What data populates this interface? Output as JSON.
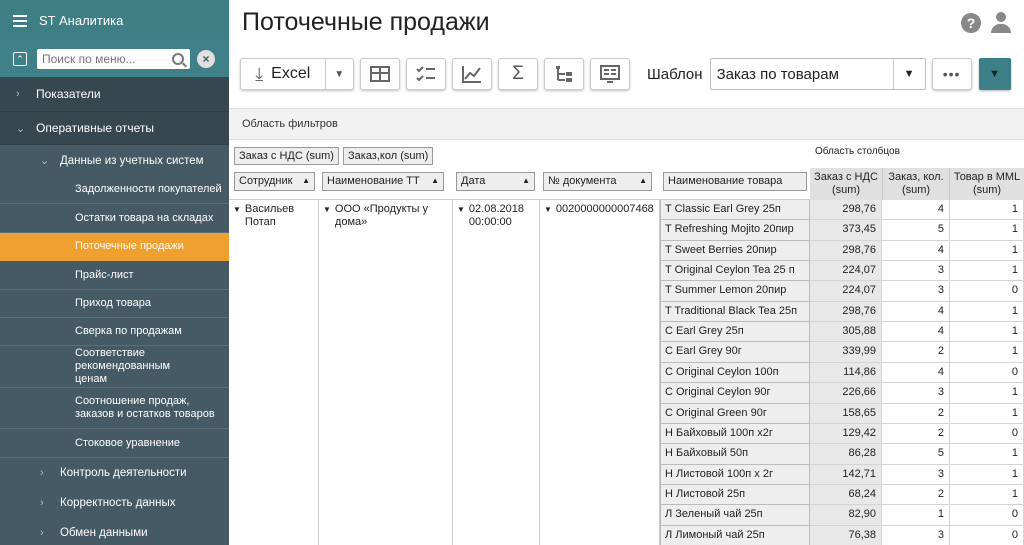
{
  "sidebar": {
    "app_title": "ST Аналитика",
    "search_placeholder": "Поиск по меню...",
    "items": [
      {
        "label": "Показатели"
      },
      {
        "label": "Оперативные отчеты"
      },
      {
        "label": "Данные из учетных систем"
      },
      {
        "label": "Задолженности покупателей"
      },
      {
        "label": "Остатки товара на складах"
      },
      {
        "label": "Поточечные продажи"
      },
      {
        "label": "Прайс-лист"
      },
      {
        "label": "Приход товара"
      },
      {
        "label": "Сверка по продажам"
      },
      {
        "label": "Соответствие рекомендованным ценам"
      },
      {
        "label": "Соотношение продаж, заказов и остатков товаров"
      },
      {
        "label": "Стоковое уравнение"
      },
      {
        "label": "Контроль деятельности"
      },
      {
        "label": "Корректность данных"
      },
      {
        "label": "Обмен данными"
      }
    ]
  },
  "header": {
    "title": "Поточечные продажи"
  },
  "toolbar": {
    "excel_label": "Excel",
    "template_label": "Шаблон",
    "template_value": "Заказ по товарам",
    "more_label": "•••"
  },
  "filters": {
    "area_label": "Область фильтров",
    "columns_area_label": "Область столбцов"
  },
  "value_chips": [
    "Заказ с НДС (sum)",
    "Заказ,кол (sum)"
  ],
  "row_headers": [
    "Сотрудник",
    "Наименование ТТ",
    "Дата",
    "№ документа",
    "Наименование товара"
  ],
  "column_headers": [
    "Заказ с НДС (sum)",
    "Заказ, кол. (sum)",
    "Товар в MML (sum)"
  ],
  "row_group": {
    "employee": "Васильев Потап",
    "store": "ООО «Продукты у дома»",
    "date": "02.08.2018 00:00:00",
    "doc": "0020000000007468"
  },
  "products": [
    {
      "name": "T Classic Earl Grey 25п",
      "sum": "298,76",
      "qty": "4",
      "mml": "1"
    },
    {
      "name": "T Refreshing Mojito 20пир",
      "sum": "373,45",
      "qty": "5",
      "mml": "1"
    },
    {
      "name": "T Sweet Berries 20пир",
      "sum": "298,76",
      "qty": "4",
      "mml": "1"
    },
    {
      "name": "T Original Ceylon Tea 25 п",
      "sum": "224,07",
      "qty": "3",
      "mml": "1"
    },
    {
      "name": "T Summer Lemon 20пир",
      "sum": "224,07",
      "qty": "3",
      "mml": "0"
    },
    {
      "name": "T Traditional Black Tea 25п",
      "sum": "298,76",
      "qty": "4",
      "mml": "1"
    },
    {
      "name": "C Earl Grey 25п",
      "sum": "305,88",
      "qty": "4",
      "mml": "1"
    },
    {
      "name": "C Earl Grey 90г",
      "sum": "339,99",
      "qty": "2",
      "mml": "1"
    },
    {
      "name": "C Original Ceylon 100п",
      "sum": "114,86",
      "qty": "4",
      "mml": "0"
    },
    {
      "name": "C Original Ceylon 90г",
      "sum": "226,66",
      "qty": "3",
      "mml": "1"
    },
    {
      "name": "C Original Green 90г",
      "sum": "158,65",
      "qty": "2",
      "mml": "1"
    },
    {
      "name": "Н Байховый 100п х2г",
      "sum": "129,42",
      "qty": "2",
      "mml": "0"
    },
    {
      "name": "Н Байховый 50п",
      "sum": "86,28",
      "qty": "5",
      "mml": "1"
    },
    {
      "name": "Н Листовой 100п х 2г",
      "sum": "142,71",
      "qty": "3",
      "mml": "1"
    },
    {
      "name": "Н Листовой 25п",
      "sum": "68,24",
      "qty": "2",
      "mml": "1"
    },
    {
      "name": "Л Зеленый чай 25п",
      "sum": "82,90",
      "qty": "1",
      "mml": "0"
    },
    {
      "name": "Л Лимоный чай 25п",
      "sum": "76,38",
      "qty": "3",
      "mml": "0"
    }
  ]
}
